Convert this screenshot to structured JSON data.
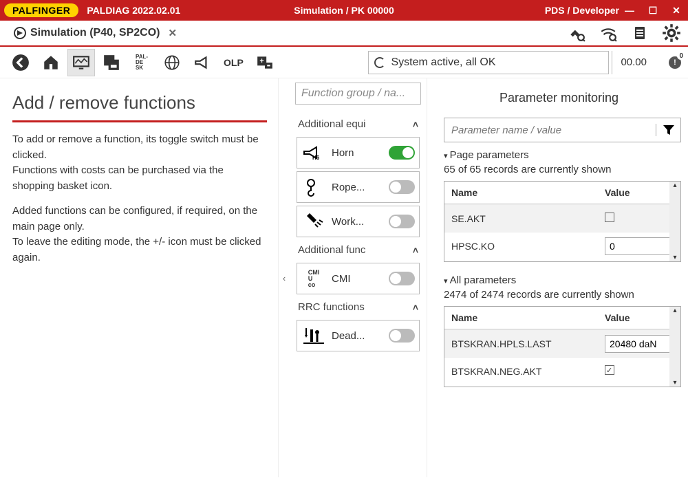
{
  "title": {
    "brand": "PALFINGER",
    "app": "PALDIAG 2022.02.01",
    "center": "Simulation / PK 00000",
    "right": "PDS / Developer"
  },
  "tab": {
    "label": "Simulation (P40, SP2CO)"
  },
  "toolbar": {
    "paldesk": "PAL-\nDE\nSK",
    "olp": "OLP",
    "status": "System active, all OK",
    "status_num": "00.00",
    "err_badge": "0",
    "err_mark": "!"
  },
  "left": {
    "heading": "Add / remove functions",
    "p1": "To add or remove a function, its toggle switch must be clicked.",
    "p2": "Functions with costs can be purchased via the shopping basket icon.",
    "p3": "Added functions can be configured, if required, on the main page only.",
    "p4": "To leave the editing mode, the +/- icon must be clicked again."
  },
  "mid": {
    "search_placeholder": "Function group / na...",
    "groups": {
      "equip": "Additional equi",
      "func": "Additional func",
      "rrc": "RRC functions"
    },
    "items": {
      "horn": "Horn",
      "rope": "Rope...",
      "work": "Work...",
      "cmi": "CMI",
      "dead": "Dead..."
    }
  },
  "right": {
    "title": "Parameter monitoring",
    "search_placeholder": "Parameter name / value",
    "page_head": "Page parameters",
    "page_count": "65 of 65 records are currently shown",
    "all_head": "All parameters",
    "all_count": "2474 of 2474 records are currently shown",
    "col_name": "Name",
    "col_value": "Value",
    "page_rows": [
      {
        "name": "SE.AKT",
        "value_type": "check",
        "value": false
      },
      {
        "name": "HPSC.KO",
        "value_type": "text",
        "value": "0"
      }
    ],
    "all_rows": [
      {
        "name": "BTSKRAN.HPLS.LAST",
        "value_type": "text",
        "value": "20480 daN"
      },
      {
        "name": "BTSKRAN.NEG.AKT",
        "value_type": "check",
        "value": true
      }
    ]
  }
}
